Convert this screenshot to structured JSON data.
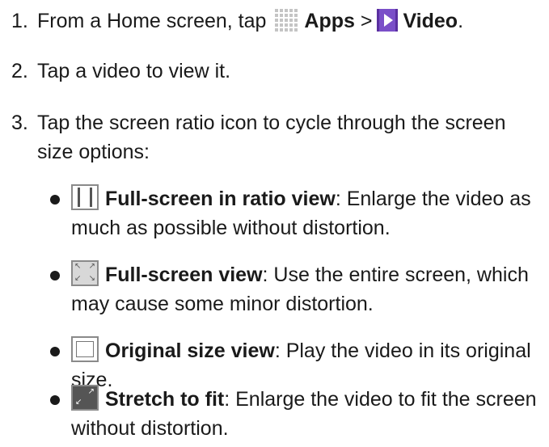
{
  "steps": [
    {
      "num": "1.",
      "prefix": "From a Home screen, tap",
      "apps_label": "Apps",
      "separator": ">",
      "video_label": "Video",
      "suffix": "."
    },
    {
      "num": "2.",
      "text": "Tap a video to view it."
    },
    {
      "num": "3.",
      "text": "Tap the screen ratio icon to cycle through the screen size options:"
    }
  ],
  "options": [
    {
      "icon": "full-screen-ratio-icon",
      "title": "Full-screen in ratio view",
      "desc": ": Enlarge the video as much as possible without distortion."
    },
    {
      "icon": "full-screen-icon",
      "title": "Full-screen view",
      "desc": ": Use the entire screen, which may cause some minor distortion."
    },
    {
      "icon": "original-size-icon",
      "title": "Original size view",
      "desc": ": Play the video in its original size."
    },
    {
      "icon": "stretch-to-fit-icon",
      "title": "Stretch to fit",
      "desc": ": Enlarge the video to fit the screen without distortion."
    }
  ],
  "colors": {
    "video_icon": "#7a4fc8",
    "apps_icon": "#c4c4c4",
    "text": "#1a1a1a"
  }
}
